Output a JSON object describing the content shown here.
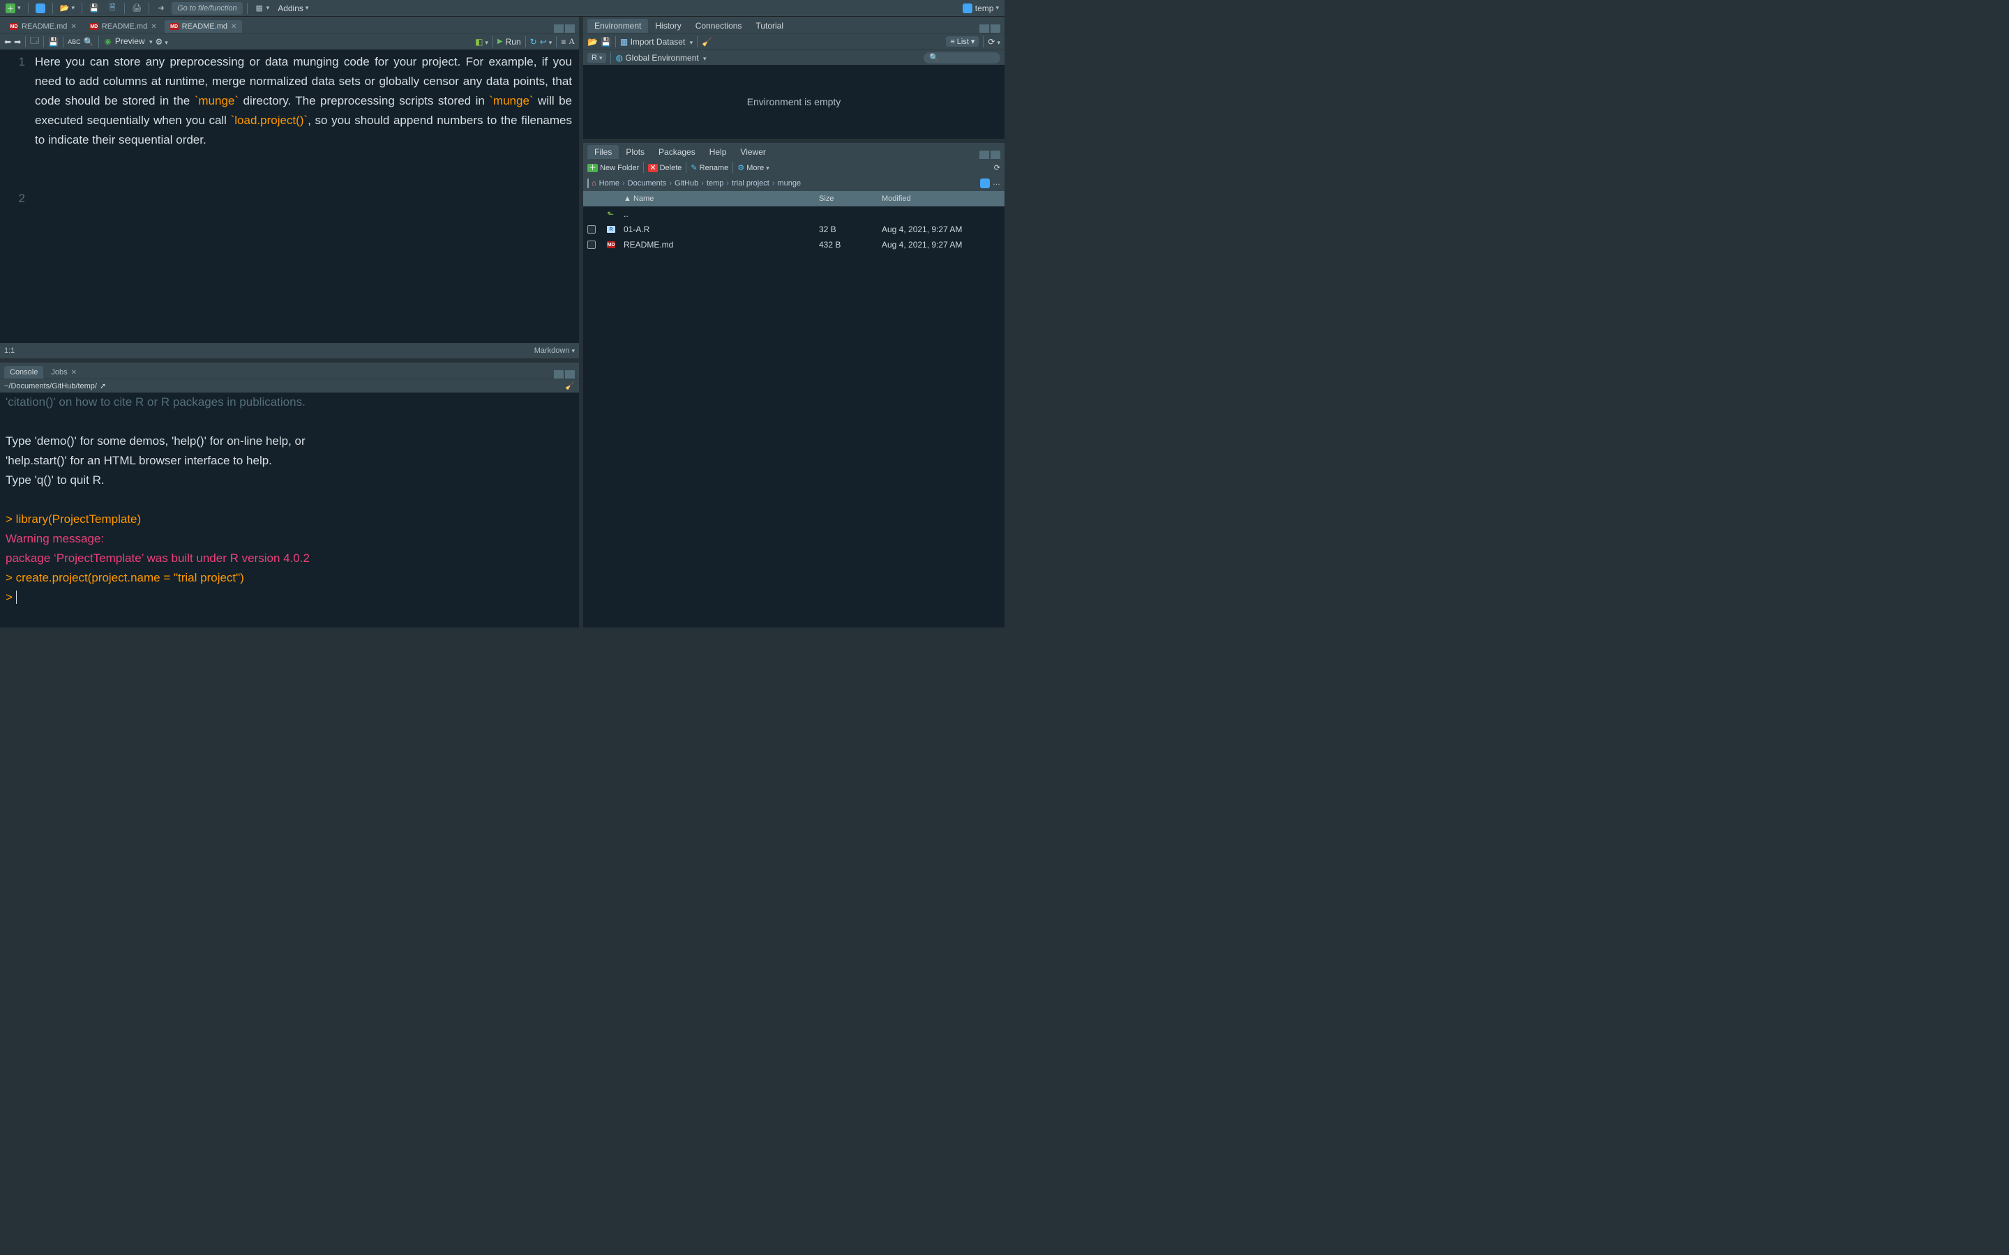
{
  "topbar": {
    "goto_placeholder": "Go to file/function",
    "addins_label": "Addins",
    "project_label": "temp"
  },
  "source": {
    "tabs": [
      {
        "label": "README.md"
      },
      {
        "label": "README.md"
      },
      {
        "label": "README.md"
      }
    ],
    "preview_label": "Preview",
    "run_label": "Run",
    "content_plain": "Here you can store any preprocessing or data munging code for your project. For example, if you need to add columns at runtime, merge normalized data sets or globally censor any data points, that code should be stored in the ",
    "munge1": "`munge`",
    "content_mid": " directory. The preprocessing scripts stored in ",
    "munge2": "`munge`",
    "content_mid2": " will be executed sequentially when you call ",
    "loadproj": "`load.project()`",
    "content_tail": ", so you should append numbers to the filenames to indicate their sequential order.",
    "line1": "1",
    "line2": "2"
  },
  "statusbar": {
    "pos": "1:1",
    "mode": "Markdown"
  },
  "console": {
    "tabs": {
      "console": "Console",
      "jobs": "Jobs"
    },
    "path": "~/Documents/GitHub/temp/",
    "scroll_line": "'citation()' on how to cite R or R packages in publications.",
    "demo_line": "Type 'demo()' for some demos, 'help()' for on-line help, or",
    "helpstart_line": "'help.start()' for an HTML browser interface to help.",
    "quit_line": "Type 'q()' to quit R.",
    "cmd1": "library(ProjectTemplate)",
    "warn_head": "Warning message:",
    "warn_body": "package ‘ProjectTemplate’ was built under R version 4.0.2",
    "cmd2": "create.project(project.name = \"trial project\")",
    "prompt": ">"
  },
  "env": {
    "tabs": {
      "environment": "Environment",
      "history": "History",
      "connections": "Connections",
      "tutorial": "Tutorial"
    },
    "import_label": "Import Dataset",
    "list_label": "List",
    "scope_label_r": "R",
    "scope_label": "Global Environment",
    "empty_text": "Environment is empty"
  },
  "files": {
    "tabs": {
      "files": "Files",
      "plots": "Plots",
      "packages": "Packages",
      "help": "Help",
      "viewer": "Viewer"
    },
    "actions": {
      "newfolder": "New Folder",
      "delete": "Delete",
      "rename": "Rename",
      "more": "More"
    },
    "breadcrumbs": [
      "Home",
      "Documents",
      "GitHub",
      "temp",
      "trial project",
      "munge"
    ],
    "columns": {
      "name": "Name",
      "size": "Size",
      "modified": "Modified"
    },
    "updots": "..",
    "rows": [
      {
        "icon": "r",
        "name": "01-A.R",
        "size": "32 B",
        "modified": "Aug 4, 2021, 9:27 AM"
      },
      {
        "icon": "md",
        "name": "README.md",
        "size": "432 B",
        "modified": "Aug 4, 2021, 9:27 AM"
      }
    ]
  }
}
